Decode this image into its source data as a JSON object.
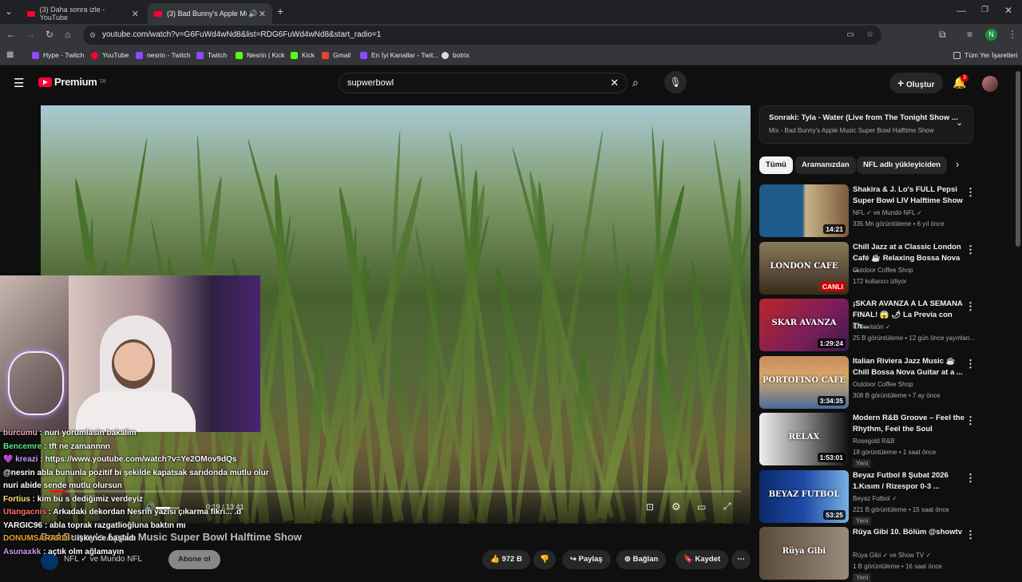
{
  "browser": {
    "tabs": [
      {
        "title": "(3) Daha sonra izle - YouTube"
      },
      {
        "title": "(3) Bad Bunny's Apple Music"
      }
    ],
    "new_tab_label": "+",
    "url": "youtube.com/watch?v=G6FuWd4wNd8&list=RDG6FuWd4wNd8&start_radio=1",
    "profile_initial": "N",
    "bookmarks": [
      "Hype - Twitch",
      "YouTube",
      "nesrin - Twitch",
      "Twitch",
      "Nesrin | Kick",
      "Kick",
      "Gmail",
      "En İyi Kanallar - Twit...",
      "botrix"
    ],
    "all_bookmarks_label": "Tüm Yer İşaretleri"
  },
  "youtube": {
    "logo_text": "Premium",
    "logo_sup": "TR",
    "search_value": "supwerbowl",
    "create_label": "Oluştur",
    "notif_count": "3",
    "video": {
      "time": "0:19 / 13:41",
      "title": "Bad Bunny's Apple Music Super Bowl Halftime Show",
      "channel": "NFL",
      "collab": "ve Mundo NFL",
      "subscribe_label": "Abone ol",
      "likes": "972 B",
      "share_label": "Paylaş",
      "connect_label": "Bağlan",
      "save_label": "Kaydet",
      "progress_fraction": 0.023,
      "volume_fraction": 0.6
    },
    "up_next": {
      "label": "Sonraki: Tyla - Water (Live from The Tonight Show ...",
      "mix": "Mix - Bad Bunny's Apple Music Super Bowl Halftime Show"
    },
    "chips": [
      "Tümü",
      "Aramanızdan",
      "NFL adlı yükleyiciden"
    ],
    "recommendations": [
      {
        "title": "Shakira & J. Lo's FULL Pepsi Super Bowl LIV Halftime Show",
        "channel": "NFL ✓ ve Mundo NFL ✓",
        "meta": "335 Mn görüntüleme • 6 yıl önce",
        "duration": "14:21",
        "thumb_text": "",
        "badge": ""
      },
      {
        "title": "Chill Jazz at a Classic London Café ☕ Relaxing Bossa Nova ...",
        "channel": "Outdoor Coffee Shop",
        "meta": "172 kullanıcı izliyor",
        "duration": "CANLI",
        "thumb_text": "LONDON CAFE",
        "badge": ""
      },
      {
        "title": "¡SKAR AVANZA A LA SEMANA FINAL! 😱 🌶 La Previa con Th...",
        "channel": "Chilevisión ✓",
        "meta": "25 B görüntüleme • 12 gün önce yayınlan...",
        "duration": "1:29:24",
        "thumb_text": "SKAR AVANZA",
        "badge": ""
      },
      {
        "title": "Italian Riviera Jazz Music ☕ Chill Bossa Nova Guitar at a ...",
        "channel": "Outdoor Coffee Shop",
        "meta": "308 B görüntüleme • 7 ay önce",
        "duration": "3:34:35",
        "thumb_text": "PORTOFINO CAFE",
        "badge": ""
      },
      {
        "title": "Modern R&B Groove – Feel the Rhythm, Feel the Soul",
        "channel": "Rosegold R&B",
        "meta": "18 görüntüleme • 1 saat önce",
        "duration": "1:53:01",
        "thumb_text": "RELAX",
        "badge": "Yeni"
      },
      {
        "title": "Beyaz Futbol 8 Şubat 2026 1.Kısım / Rizespor 0-3 ...",
        "channel": "Beyaz Futbol ✓",
        "meta": "221 B görüntüleme • 15 saat önce",
        "duration": "53:25",
        "thumb_text": "BEYAZ FUTBOL",
        "badge": "Yeni"
      },
      {
        "title": "Rüya Gibi 10. Bölüm @showtv",
        "channel": "Rüya Gibi ✓ ve Show TV ✓",
        "meta": "1 B görüntüleme • 16 saat önce",
        "duration": "",
        "thumb_text": "Rüya Gibi",
        "badge": "Yeni"
      }
    ]
  },
  "chat": [
    {
      "user": "burcumu",
      "color": "#f2a7c3",
      "msg": ": nuri yorumlasin bakalim"
    },
    {
      "user": "Bencemre",
      "color": "#5ee38b",
      "msg": ": tft ne zamannnn"
    },
    {
      "user": "💜 kreazi",
      "color": "#c69cf7",
      "msg": ": https://www.youtube.com/watch?v=Ye2OMov9dQs"
    },
    {
      "user": "",
      "color": "#ffffff",
      "msg": "@nesrin abla bununla pozitif bi şekilde kapatsak sarıdonda mutlu olur nuri abide sende mutlu olursun"
    },
    {
      "user": "Fortius",
      "color": "#f4e46b",
      "msg": ": kim bu s dediğimiz verdeyiz"
    },
    {
      "user": "Utangacnis",
      "color": "#ff6b6b",
      "msg": ": Arkadaki dekordan Nesrin yazısı çıkarma fikri... .d"
    },
    {
      "user": "YARGIC96",
      "color": "#ffffff",
      "msg": ": abla toprak razgatlioğluna baktın mı"
    },
    {
      "user": "DONUMSARARDI",
      "color": "#f0a030",
      "msg": ": işkence başladı"
    },
    {
      "user": "Asunaxkk",
      "color": "#c69cf7",
      "msg": ": açtık olm ağlamayın"
    }
  ],
  "colors": {
    "yt_red": "#ff0033",
    "bg": "#0f0f0f"
  }
}
